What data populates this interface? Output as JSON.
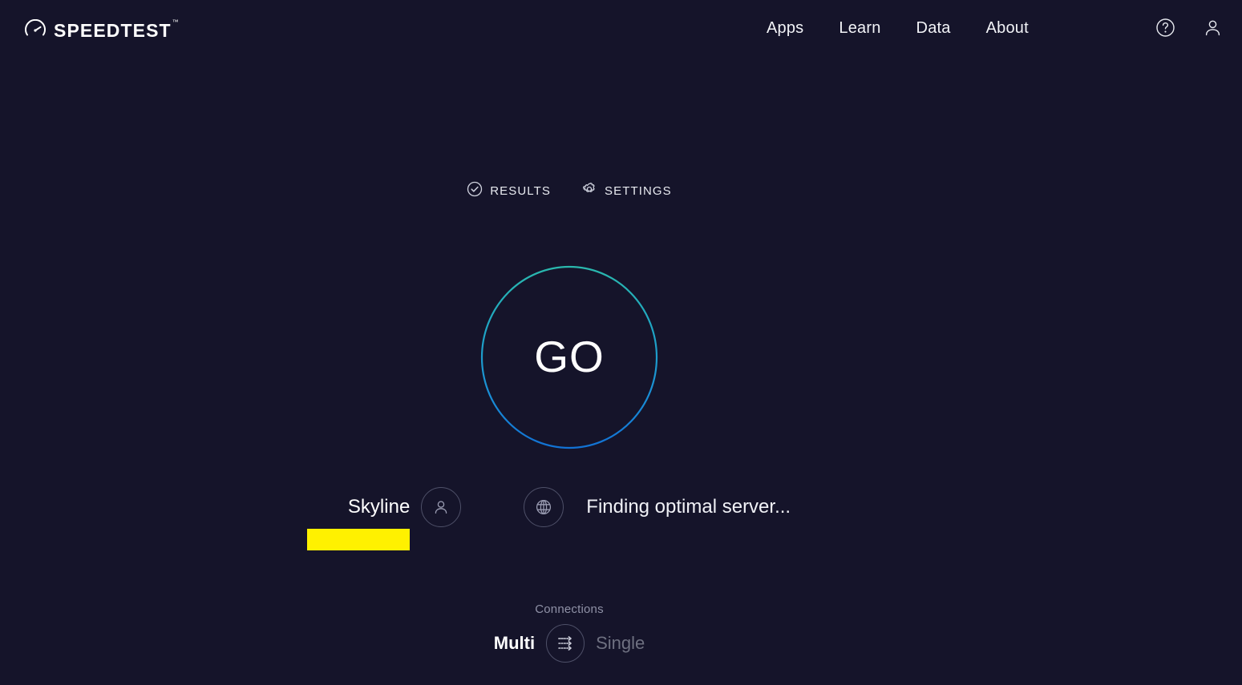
{
  "theme": {
    "background": "#15142a",
    "text_primary": "#ffffff",
    "text_muted": "#8f91a6",
    "accent_teal": "#2ab8ad",
    "accent_blue": "#1a7fd8",
    "redaction_yellow": "#fff100",
    "icon_stroke": "#9a9cb2"
  },
  "header": {
    "logo_text": "SPEEDTEST",
    "logo_trademark": "™",
    "logo_icon": "speedometer-icon",
    "nav": [
      {
        "label": "Apps",
        "name": "nav-apps"
      },
      {
        "label": "Learn",
        "name": "nav-learn"
      },
      {
        "label": "Data",
        "name": "nav-data"
      },
      {
        "label": "About",
        "name": "nav-about"
      }
    ],
    "icons": [
      {
        "name": "help-icon",
        "glyph": "question-circle"
      },
      {
        "name": "account-icon",
        "glyph": "person"
      }
    ]
  },
  "tabs": [
    {
      "label": "RESULTS",
      "icon": "check-circle-icon",
      "name": "tab-results"
    },
    {
      "label": "SETTINGS",
      "icon": "gear-icon",
      "name": "tab-settings"
    }
  ],
  "go_button": {
    "label": "GO",
    "state": "idle",
    "gradient_top": "#2ab8ad",
    "gradient_bottom": "#1a7fd8"
  },
  "connection_info": {
    "isp_name": "Skyline",
    "ip_address_redacted": true,
    "isp_icon": "person-icon",
    "server_icon": "globe-icon",
    "server_status": "Finding optimal server..."
  },
  "connections": {
    "label": "Connections",
    "icon": "multi-arrows-icon",
    "options": [
      {
        "label": "Multi",
        "selected": true
      },
      {
        "label": "Single",
        "selected": false
      }
    ]
  }
}
